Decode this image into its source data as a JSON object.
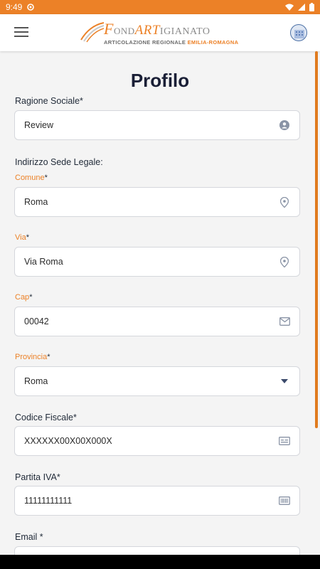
{
  "status": {
    "time": "9:49"
  },
  "header": {
    "logo_f": "F",
    "logo_ond": "OND",
    "logo_art": "ART",
    "logo_rest": "IGIANATO",
    "logo_sub_a": "ARTICOLAZIONE REGIONALE ",
    "logo_sub_b": "EMILIA-ROMAGNA"
  },
  "page": {
    "title": "Profilo"
  },
  "form": {
    "ragione_sociale": {
      "label": "Ragione Sociale",
      "value": "Review"
    },
    "indirizzo_heading": "Indirizzo Sede Legale:",
    "comune": {
      "label": "Comune",
      "value": "Roma"
    },
    "via": {
      "label": "Via",
      "value": "Via Roma"
    },
    "cap": {
      "label": "Cap",
      "value": "00042"
    },
    "provincia": {
      "label": "Provincia",
      "value": "Roma"
    },
    "codice_fiscale": {
      "label": "Codice Fiscale",
      "value": "XXXXXX00X00X000X"
    },
    "partita_iva": {
      "label": "Partita IVA",
      "value": "11111111111"
    },
    "email": {
      "label": "Email "
    },
    "required_mark": "*"
  },
  "colors": {
    "accent": "#ec8127",
    "title": "#1a1f36",
    "icon": "#8a94a6"
  },
  "icons": [
    "menu-icon",
    "user-circle-icon",
    "map-pin-icon",
    "mail-icon",
    "chevron-down-icon",
    "id-card-icon",
    "barcode-icon"
  ]
}
